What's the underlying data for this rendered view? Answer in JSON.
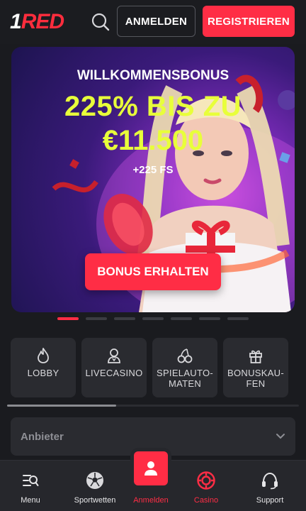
{
  "header": {
    "logo_one": "1",
    "logo_red": "RED",
    "login_label": "ANMELDEN",
    "register_label": "REGISTRIEREN"
  },
  "banner": {
    "eyebrow": "WILLKOMMENSBONUS",
    "headline": "225% BIS ZU",
    "amount": "€11.500",
    "free_spins": "+225 FS",
    "cta_label": "BONUS ERHALTEN"
  },
  "carousel": {
    "slides": 7,
    "active_index": 0
  },
  "categories": [
    {
      "label": "LOBBY",
      "icon": "flame-icon"
    },
    {
      "label": "LIVECASINO",
      "icon": "dealer-icon"
    },
    {
      "label": "SPIELAUTO-\nMATEN",
      "icon": "cherries-icon"
    },
    {
      "label": "BONUSKAU-\nFEN",
      "icon": "gift-icon"
    }
  ],
  "provider_select": {
    "label": "Anbieter"
  },
  "bottom_nav": {
    "items": [
      {
        "label": "Menu",
        "icon": "menu-search-icon"
      },
      {
        "label": "Sportwetten",
        "icon": "soccer-ball-icon"
      },
      {
        "label": "Anmelden",
        "icon": "user-icon"
      },
      {
        "label": "Casino",
        "icon": "casino-chip-icon"
      },
      {
        "label": "Support",
        "icon": "headset-icon"
      }
    ]
  },
  "colors": {
    "accent": "#ff2d45",
    "headline_yellow": "#e8ff3a",
    "background": "#1a1b1f",
    "tile": "#2a2b30"
  }
}
